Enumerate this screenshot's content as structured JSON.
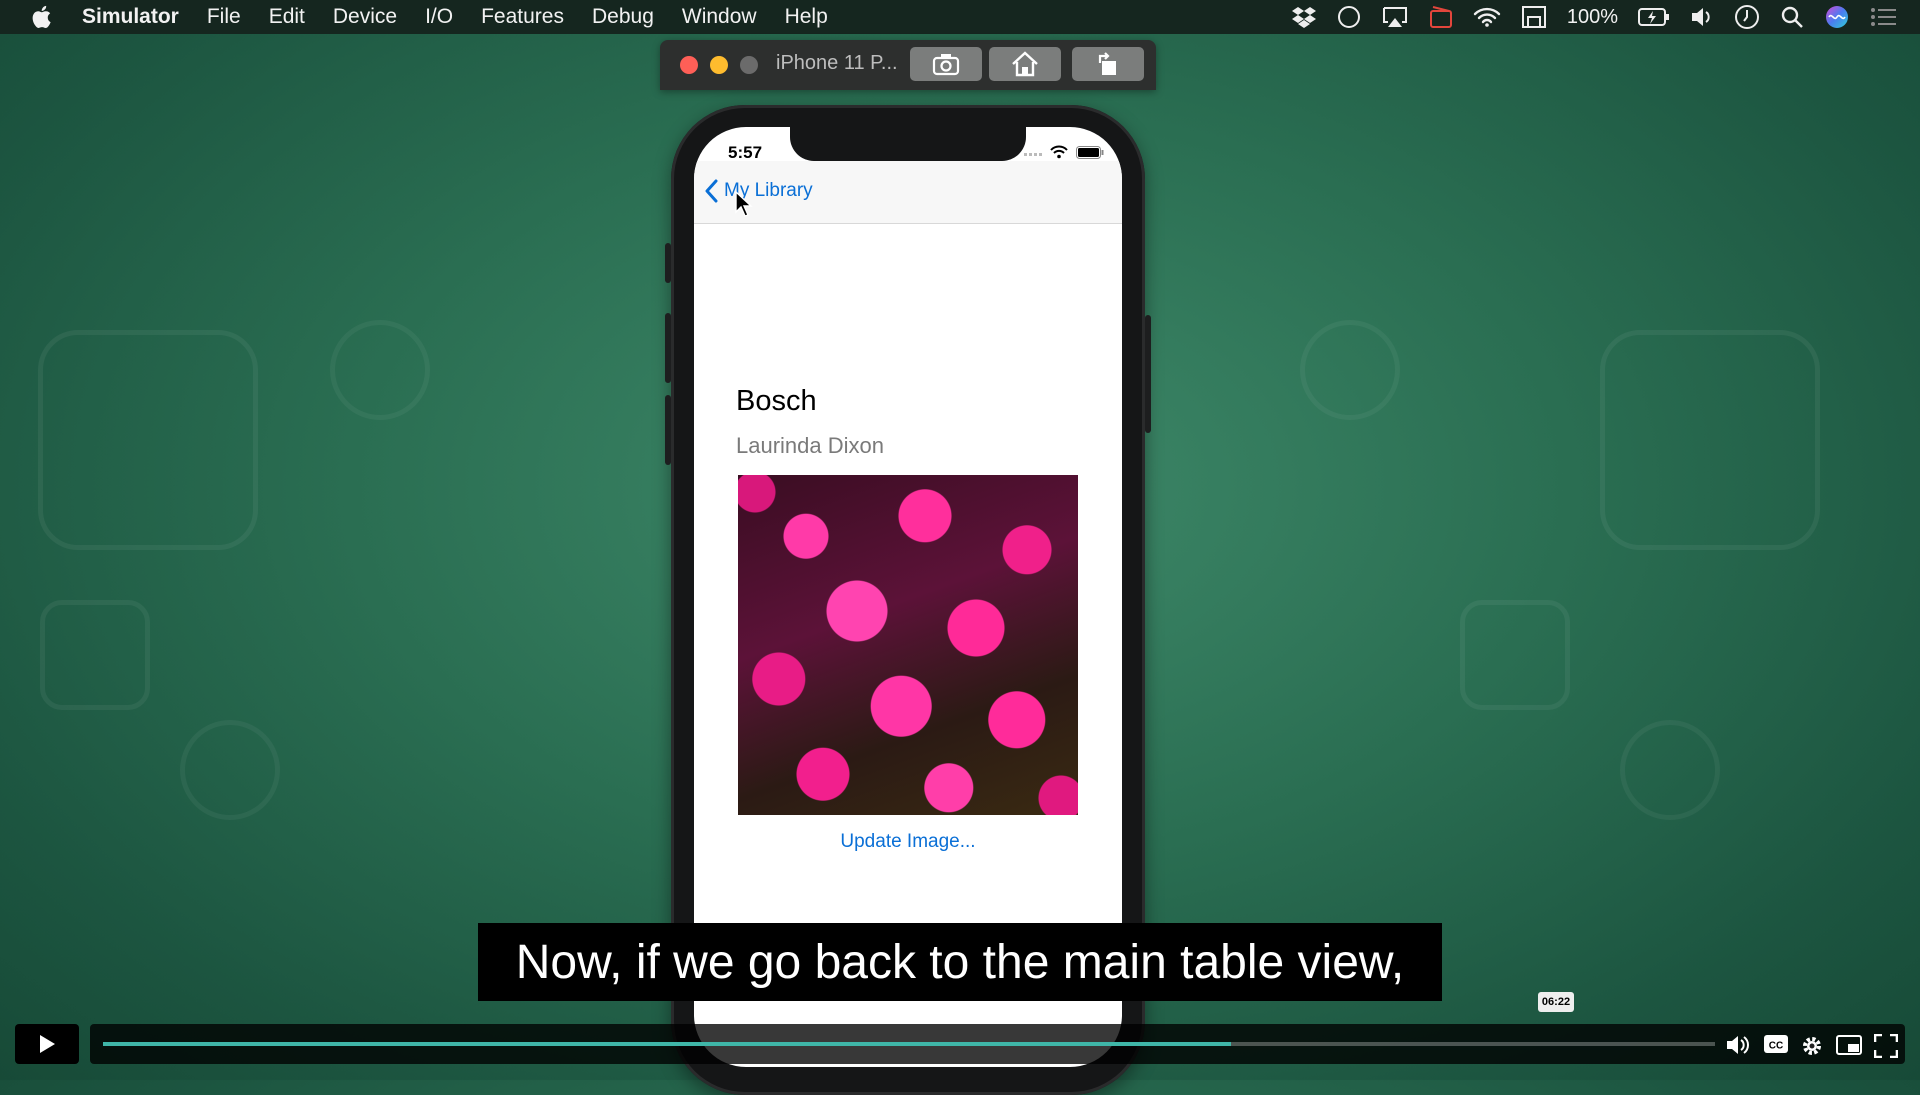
{
  "menubar": {
    "app_name": "Simulator",
    "menus": [
      "File",
      "Edit",
      "Device",
      "I/O",
      "Features",
      "Debug",
      "Window",
      "Help"
    ],
    "battery": "100%",
    "icons": [
      "dropbox-icon",
      "circle-icon",
      "airplay-icon",
      "screen-record-icon",
      "wifi-icon",
      "display-icon",
      "battery-charging-icon",
      "volume-icon",
      "time-machine-icon",
      "spotlight-search-icon",
      "siri-icon",
      "notification-center-icon"
    ]
  },
  "simulator": {
    "window_title": "iPhone 11 P...",
    "toolbar": [
      "screenshot-icon",
      "home-icon",
      "rotate-icon"
    ]
  },
  "phone": {
    "status_time": "5:57",
    "nav": {
      "back_label": "My Library"
    },
    "book": {
      "title": "Bosch",
      "author": "Laurinda Dixon"
    },
    "update_button": "Update Image..."
  },
  "video": {
    "caption": "Now, if we go back to the main table view,",
    "time_tooltip": "06:22",
    "progress": 0.7,
    "progress_color": "#3fb6a8",
    "controls": [
      "play-icon",
      "volume-icon",
      "cc-icon",
      "settings-icon",
      "pip-icon",
      "fullscreen-icon"
    ]
  }
}
